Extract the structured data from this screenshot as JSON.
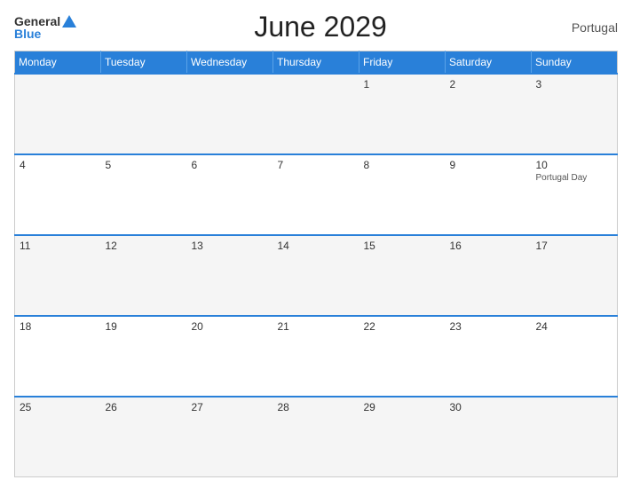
{
  "header": {
    "logo": {
      "general": "General",
      "blue": "Blue",
      "triangle": true
    },
    "title": "June 2029",
    "country": "Portugal"
  },
  "calendar": {
    "days_of_week": [
      "Monday",
      "Tuesday",
      "Wednesday",
      "Thursday",
      "Friday",
      "Saturday",
      "Sunday"
    ],
    "weeks": [
      [
        {
          "day": "",
          "holiday": ""
        },
        {
          "day": "",
          "holiday": ""
        },
        {
          "day": "",
          "holiday": ""
        },
        {
          "day": "1",
          "holiday": ""
        },
        {
          "day": "2",
          "holiday": ""
        },
        {
          "day": "3",
          "holiday": ""
        }
      ],
      [
        {
          "day": "4",
          "holiday": ""
        },
        {
          "day": "5",
          "holiday": ""
        },
        {
          "day": "6",
          "holiday": ""
        },
        {
          "day": "7",
          "holiday": ""
        },
        {
          "day": "8",
          "holiday": ""
        },
        {
          "day": "9",
          "holiday": ""
        },
        {
          "day": "10",
          "holiday": "Portugal Day"
        }
      ],
      [
        {
          "day": "11",
          "holiday": ""
        },
        {
          "day": "12",
          "holiday": ""
        },
        {
          "day": "13",
          "holiday": ""
        },
        {
          "day": "14",
          "holiday": ""
        },
        {
          "day": "15",
          "holiday": ""
        },
        {
          "day": "16",
          "holiday": ""
        },
        {
          "day": "17",
          "holiday": ""
        }
      ],
      [
        {
          "day": "18",
          "holiday": ""
        },
        {
          "day": "19",
          "holiday": ""
        },
        {
          "day": "20",
          "holiday": ""
        },
        {
          "day": "21",
          "holiday": ""
        },
        {
          "day": "22",
          "holiday": ""
        },
        {
          "day": "23",
          "holiday": ""
        },
        {
          "day": "24",
          "holiday": ""
        }
      ],
      [
        {
          "day": "25",
          "holiday": ""
        },
        {
          "day": "26",
          "holiday": ""
        },
        {
          "day": "27",
          "holiday": ""
        },
        {
          "day": "28",
          "holiday": ""
        },
        {
          "day": "29",
          "holiday": ""
        },
        {
          "day": "30",
          "holiday": ""
        },
        {
          "day": "",
          "holiday": ""
        }
      ]
    ]
  }
}
